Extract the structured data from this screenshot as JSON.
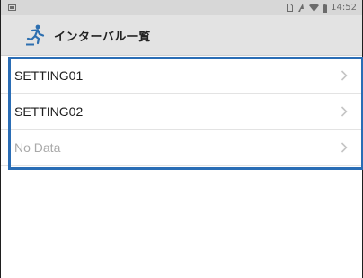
{
  "status_bar": {
    "time": "14:52",
    "icons": [
      "notification-icon",
      "sim-icon",
      "signal-icon",
      "wifi-icon",
      "battery-icon"
    ]
  },
  "app_bar": {
    "logo": "runner-icon",
    "title": "インターバル一覧"
  },
  "list": {
    "items": [
      {
        "label": "SETTING01"
      },
      {
        "label": "SETTING02"
      },
      {
        "label": "No Data"
      }
    ]
  },
  "colors": {
    "highlight": "#2a6db5",
    "logo": "#2d6fb0",
    "muted_text": "#a9a9a9",
    "app_bar": "#e3e3e3"
  }
}
